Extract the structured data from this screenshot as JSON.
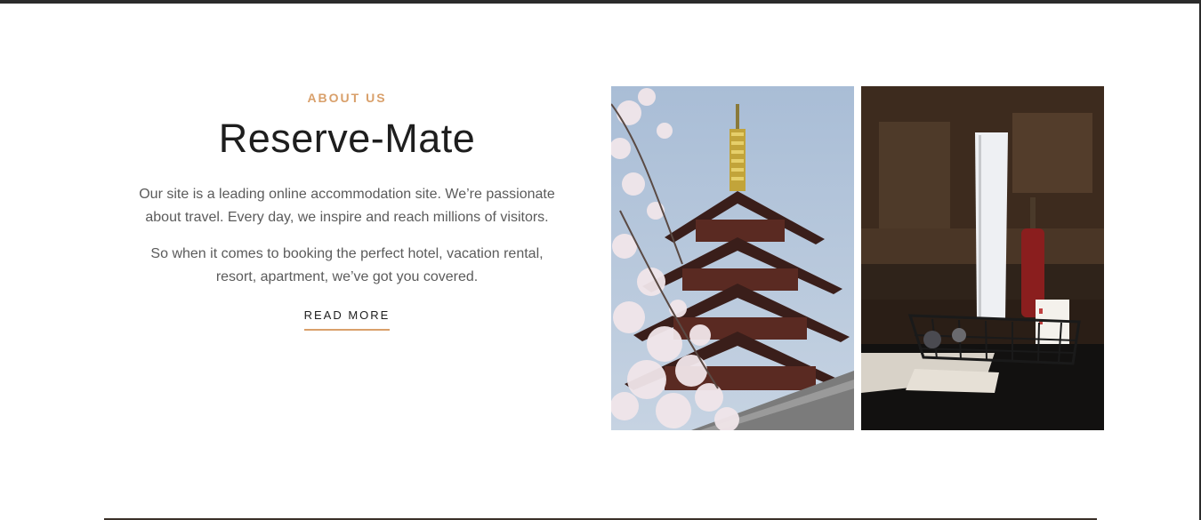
{
  "about": {
    "eyebrow": "ABOUT US",
    "title": "Reserve-Mate",
    "paragraph_1": "Our site is a leading online accommodation site. We’re passionate about travel. Every day, we inspire and reach millions of visitors.",
    "paragraph_2": "So when it comes to booking the perfect hotel, vacation rental, resort, apartment, we’ve got you covered.",
    "read_more_label": "READ MORE"
  },
  "images": {
    "photo_1": "pagoda with cherry blossoms",
    "photo_2": "restaurant table with menu and basket"
  },
  "colors": {
    "accent": "#d9a06b",
    "heading": "#1e1e1e",
    "body_text": "#5b5b5b",
    "frame": "#2b2b2b"
  }
}
